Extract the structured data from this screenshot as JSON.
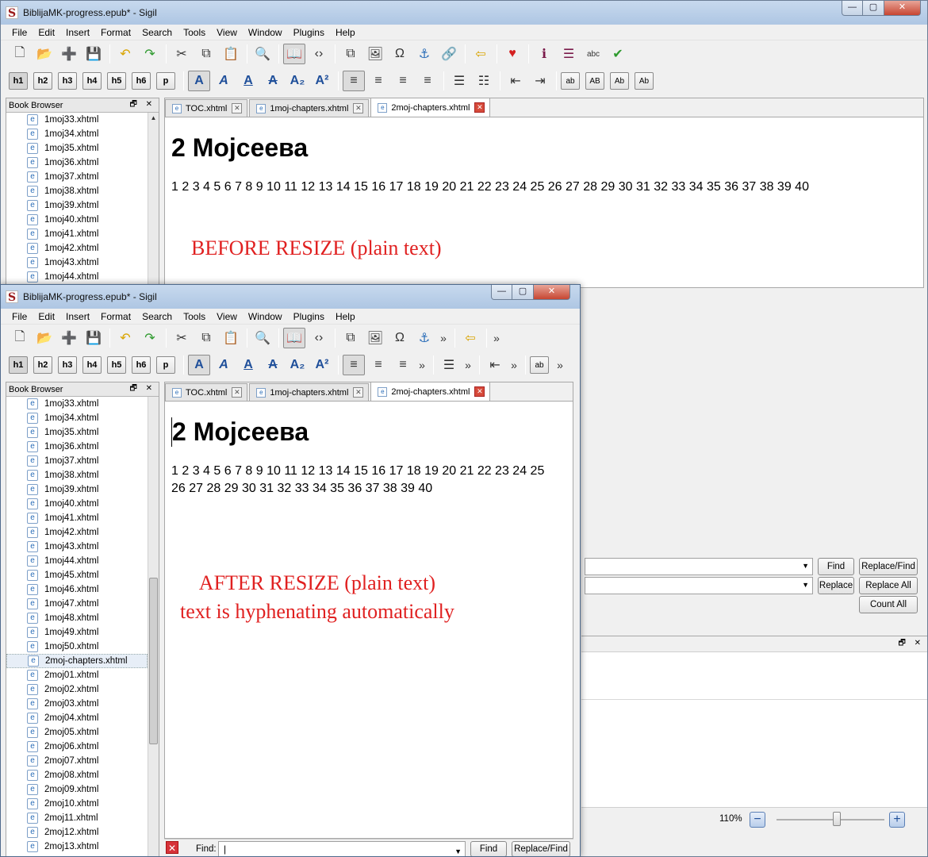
{
  "window": {
    "title": "BiblijaMK-progress.epub* - Sigil",
    "logo": "S",
    "controls": {
      "minimize": "—",
      "maximize": "▢",
      "close": "✕"
    }
  },
  "menu": [
    "File",
    "Edit",
    "Insert",
    "Format",
    "Search",
    "Tools",
    "View",
    "Window",
    "Plugins",
    "Help"
  ],
  "toolbar1": [
    {
      "icon": "new-file-icon",
      "glyph": "🗋"
    },
    {
      "icon": "open-folder-icon",
      "glyph": "📂"
    },
    {
      "icon": "add-file-icon",
      "glyph": "➕"
    },
    {
      "icon": "save-icon",
      "glyph": "💾"
    },
    {
      "sep": true
    },
    {
      "icon": "undo-icon",
      "glyph": "↶"
    },
    {
      "icon": "redo-icon",
      "glyph": "↷"
    },
    {
      "sep": true
    },
    {
      "icon": "cut-icon",
      "glyph": "✂"
    },
    {
      "icon": "copy-icon",
      "glyph": "⧉"
    },
    {
      "icon": "paste-icon",
      "glyph": "📋"
    },
    {
      "sep": true
    },
    {
      "icon": "print-preview-icon",
      "glyph": "🔍"
    },
    {
      "sep": true
    },
    {
      "icon": "book-view-icon",
      "glyph": "📖",
      "pressed": true
    },
    {
      "icon": "code-view-icon",
      "glyph": "‹›"
    },
    {
      "sep": true
    },
    {
      "icon": "split-icon",
      "glyph": "⧉"
    },
    {
      "icon": "insert-image-icon",
      "glyph": "🖼"
    },
    {
      "icon": "special-char-icon",
      "glyph": "Ω"
    },
    {
      "icon": "anchor-icon",
      "glyph": "⚓"
    },
    {
      "icon": "link-icon",
      "glyph": "🔗"
    },
    {
      "sep": true
    },
    {
      "icon": "back-arrow-icon",
      "glyph": "⇦"
    },
    {
      "sep": true
    },
    {
      "icon": "donate-heart-icon",
      "glyph": "♥"
    },
    {
      "sep": true
    },
    {
      "icon": "metadata-icon",
      "glyph": "ℹ"
    },
    {
      "icon": "toc-icon",
      "glyph": "☰"
    },
    {
      "icon": "spellcheck-icon",
      "glyph": "abc"
    },
    {
      "icon": "validate-check-icon",
      "glyph": "✔"
    }
  ],
  "toolbar2": {
    "headings": [
      "h1",
      "h2",
      "h3",
      "h4",
      "h5",
      "h6",
      "p"
    ],
    "formatting": [
      {
        "icon": "bold-icon",
        "glyph": "A"
      },
      {
        "icon": "italic-icon",
        "glyph": "A"
      },
      {
        "icon": "underline-icon",
        "glyph": "A"
      },
      {
        "icon": "strikethrough-icon",
        "glyph": "A"
      },
      {
        "icon": "subscript-icon",
        "glyph": "A₂"
      },
      {
        "icon": "superscript-icon",
        "glyph": "A²"
      }
    ],
    "align": [
      {
        "icon": "align-left-icon",
        "glyph": "≡"
      },
      {
        "icon": "align-center-icon",
        "glyph": "≡"
      },
      {
        "icon": "align-right-icon",
        "glyph": "≡"
      },
      {
        "icon": "align-justify-icon",
        "glyph": "≡"
      }
    ],
    "lists": [
      {
        "icon": "bullet-list-icon",
        "glyph": "☰"
      },
      {
        "icon": "numbered-list-icon",
        "glyph": "☷"
      }
    ],
    "indent": [
      {
        "icon": "outdent-icon",
        "glyph": "⇤"
      },
      {
        "icon": "indent-icon",
        "glyph": "⇥"
      }
    ],
    "case": [
      "ab",
      "AB",
      "Ab",
      "Ab"
    ]
  },
  "more_chevron": "»",
  "sidebar": {
    "title": "Book Browser",
    "controls": "🗗 ✕",
    "back_items": [
      "1moj33.xhtml",
      "1moj34.xhtml",
      "1moj35.xhtml",
      "1moj36.xhtml",
      "1moj37.xhtml",
      "1moj38.xhtml",
      "1moj39.xhtml",
      "1moj40.xhtml",
      "1moj41.xhtml",
      "1moj42.xhtml",
      "1moj43.xhtml",
      "1moj44.xhtml"
    ],
    "front_items": [
      "1moj33.xhtml",
      "1moj34.xhtml",
      "1moj35.xhtml",
      "1moj36.xhtml",
      "1moj37.xhtml",
      "1moj38.xhtml",
      "1moj39.xhtml",
      "1moj40.xhtml",
      "1moj41.xhtml",
      "1moj42.xhtml",
      "1moj43.xhtml",
      "1moj44.xhtml",
      "1moj45.xhtml",
      "1moj46.xhtml",
      "1moj47.xhtml",
      "1moj48.xhtml",
      "1moj49.xhtml",
      "1moj50.xhtml",
      "2moj-chapters.xhtml",
      "2moj01.xhtml",
      "2moj02.xhtml",
      "2moj03.xhtml",
      "2moj04.xhtml",
      "2moj05.xhtml",
      "2moj06.xhtml",
      "2moj07.xhtml",
      "2moj08.xhtml",
      "2moj09.xhtml",
      "2moj10.xhtml",
      "2moj11.xhtml",
      "2moj12.xhtml",
      "2moj13.xhtml"
    ],
    "selected_index": 18
  },
  "tabs": [
    {
      "label": "TOC.xhtml",
      "active": false
    },
    {
      "label": "1moj-chapters.xhtml",
      "active": false
    },
    {
      "label": "2moj-chapters.xhtml",
      "active": true
    }
  ],
  "document": {
    "heading": "2 Мојсеева",
    "chapters": "1 2 3 4 5 6 7 8 9 10 11 12 13 14 15 16 17 18 19 20 21 22 23 24 25 26 27 28 29 30 31 32 33 34 35 36 37 38 39 40"
  },
  "annotations": {
    "before": "BEFORE RESIZE (plain text)",
    "after_line1": "AFTER RESIZE (plain text)",
    "after_line2": "text is hyphenating automatically"
  },
  "find_replace": {
    "find_label": "Find:",
    "find_value": "|",
    "find_button": "Find",
    "replace_find_button": "Replace/Find",
    "replace_button": "Replace",
    "replace_all_button": "Replace All",
    "count_all_button": "Count All"
  },
  "status": {
    "zoom": "110%",
    "zoom_out": "−",
    "zoom_in": "+",
    "zoom_level": 0.56
  },
  "colors": {
    "annotation": "#e02020",
    "heart": "#d42020"
  }
}
